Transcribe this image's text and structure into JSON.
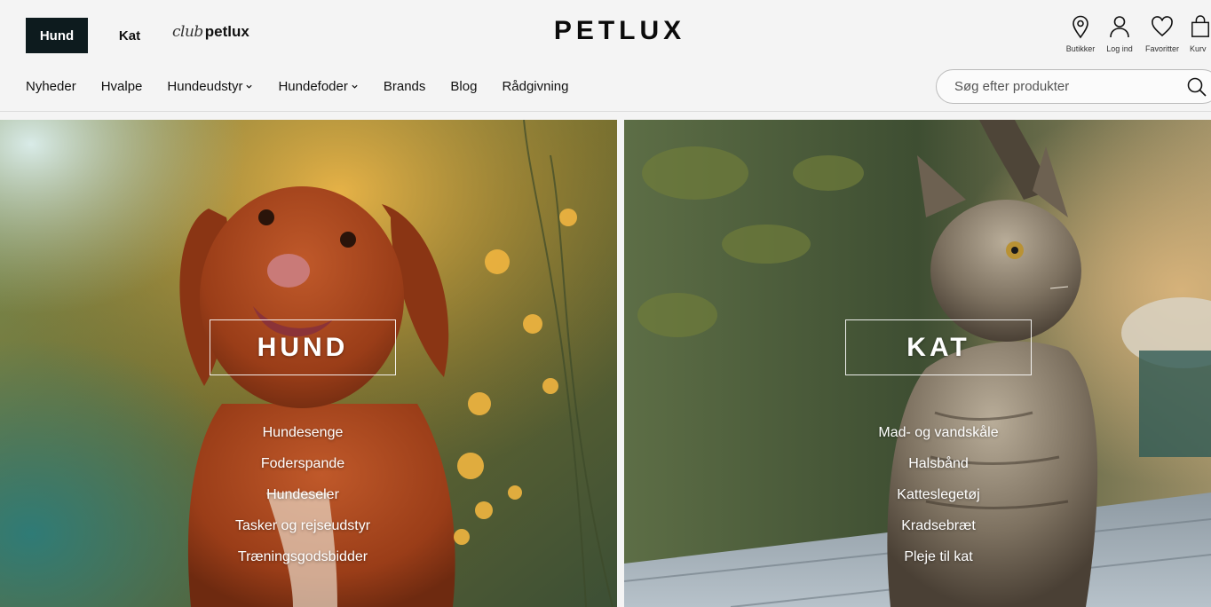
{
  "top_tabs": {
    "active": "Hund",
    "kat": "Kat"
  },
  "club": {
    "script": "club",
    "bold": "petlux"
  },
  "logo": "PETLUX",
  "utility": [
    {
      "label": "Butikker",
      "icon": "location-pin-icon"
    },
    {
      "label": "Log ind",
      "icon": "user-icon"
    },
    {
      "label": "Favoritter",
      "icon": "heart-icon"
    },
    {
      "label": "Kurv",
      "icon": "bag-icon"
    }
  ],
  "nav": [
    {
      "label": "Nyheder",
      "dropdown": false
    },
    {
      "label": "Hvalpe",
      "dropdown": false
    },
    {
      "label": "Hundeudstyr",
      "dropdown": true
    },
    {
      "label": "Hundefoder",
      "dropdown": true
    },
    {
      "label": "Brands",
      "dropdown": false
    },
    {
      "label": "Blog",
      "dropdown": false
    },
    {
      "label": "Rådgivning",
      "dropdown": false
    }
  ],
  "search": {
    "placeholder": "Søg efter produkter",
    "value": ""
  },
  "dog_panel": {
    "title": "HUND",
    "links": [
      "Hundesenge",
      "Foderspande",
      "Hundeseler",
      "Tasker og rejseudstyr",
      "Træningsgodsbidder"
    ]
  },
  "cat_panel": {
    "title": "KAT",
    "links": [
      "Mad- og vandskåle",
      "Halsbånd",
      "Katteslegetøj",
      "Kradsebræt",
      "Pleje til kat"
    ]
  },
  "colors": {
    "active_tab_bg": "#0d1b1e",
    "text": "#111111",
    "header_bg": "#f4f4f4"
  }
}
